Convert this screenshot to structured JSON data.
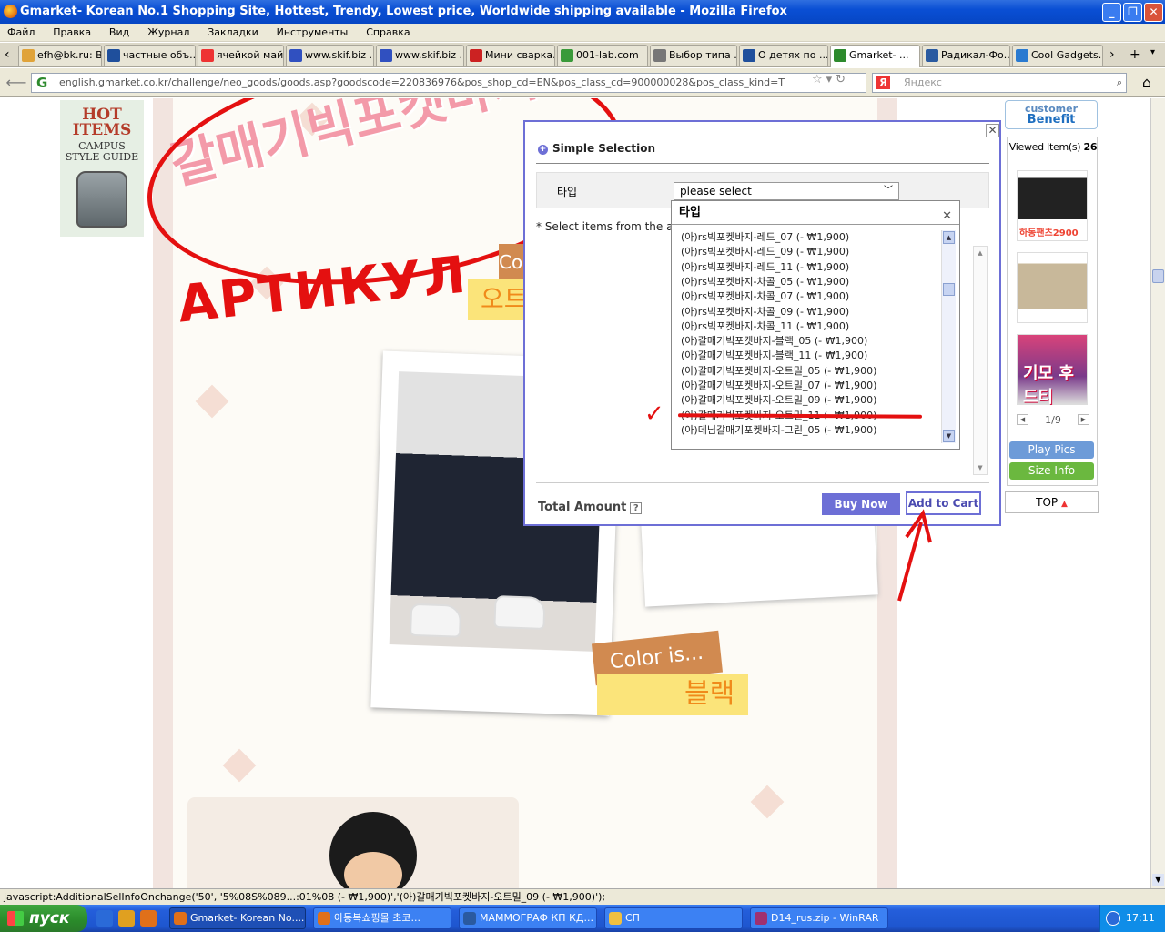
{
  "window": {
    "title": "Gmarket- Korean No.1 Shopping Site, Hottest, Trendy, Lowest price, Worldwide shipping available - Mozilla Firefox"
  },
  "menu": [
    "Файл",
    "Правка",
    "Вид",
    "Журнал",
    "Закладки",
    "Инструменты",
    "Справка"
  ],
  "tabs": [
    {
      "label": "efh@bk.ru: В...",
      "color": "#e0a33a"
    },
    {
      "label": "частные объ...",
      "color": "#1f4f9c"
    },
    {
      "label": "ячейкой май...",
      "color": "#e33"
    },
    {
      "label": "www.skif.biz ...",
      "color": "#3050c0"
    },
    {
      "label": "www.skif.biz ...",
      "color": "#3050c0"
    },
    {
      "label": "Мини сварка...",
      "color": "#c22"
    },
    {
      "label": "001-lab.com",
      "color": "#3a9a3a"
    },
    {
      "label": "Выбор типа ...",
      "color": "#777"
    },
    {
      "label": "О детях по ...",
      "color": "#1f4f9c"
    },
    {
      "label": "Gmarket- ...",
      "color": "#2d8a2d",
      "active": true
    },
    {
      "label": "Радикал-Фо...",
      "color": "#2a5aa0"
    },
    {
      "label": "Cool Gadgets...",
      "color": "#2a7ad0"
    }
  ],
  "nav": {
    "url": "english.gmarket.co.kr/challenge/neo_goods/goods.asp?goodscode=220836976&pos_shop_cd=EN&pos_class_cd=900000028&pos_class_kind=T",
    "search_placeholder": "Яндекс"
  },
  "page": {
    "hot_items": {
      "title": "HOT ITEMS",
      "subtitle": "CAMPUS STYLE GUIDE"
    },
    "product_title_ko": "갈매기빅포켓바지",
    "annotation_text": "АРТИКУЛ",
    "color_label_1": "Co",
    "color_value_1": "오트",
    "color_label_2": "Color is...",
    "color_value_2": "블랙"
  },
  "sidebar": {
    "customer": "customer",
    "benefit": "Benefit",
    "viewed_label": "Viewed Item(s)",
    "viewed_count": "26",
    "thumb1_text": "하동팬츠2900",
    "thumb3_text": "기모 후드티",
    "pager": "1/9",
    "play_pics": "Play Pics",
    "size_info": "Size Info",
    "top": "TOP"
  },
  "dialog": {
    "title": "Simple Selection",
    "type_label": "타입",
    "select_value": "please select",
    "select_note": "* Select items from the abo",
    "total_label": "Total Amount",
    "buy_now": "Buy Now",
    "add_to_cart": "Add to Cart"
  },
  "dropdown": {
    "header": "타입",
    "items": [
      "(아)rs빅포켓바지-레드_07 (- ₩1,900)",
      "(아)rs빅포켓바지-레드_09 (- ₩1,900)",
      "(아)rs빅포켓바지-레드_11 (- ₩1,900)",
      "(아)rs빅포켓바지-차콜_05 (- ₩1,900)",
      "(아)rs빅포켓바지-차콜_07 (- ₩1,900)",
      "(아)rs빅포켓바지-차콜_09 (- ₩1,900)",
      "(아)rs빅포켓바지-차콜_11 (- ₩1,900)",
      "(아)갈매기빅포켓바지-블랙_05 (- ₩1,900)",
      "(아)갈매기빅포켓바지-블랙_11 (- ₩1,900)",
      "(아)갈매기빅포켓바지-오트밀_05 (- ₩1,900)",
      "(아)갈매기빅포켓바지-오트밀_07 (- ₩1,900)",
      "(아)갈매기빅포켓바지-오트밀_09 (- ₩1,900)",
      "(아)갈매기빅포켓바지-오트밀_11 (- ₩1,900)",
      "(아)데님갈매기포켓바지-그린_05 (- ₩1,900)"
    ]
  },
  "status": "javascript:AdditionalSelInfoOnchange('50', '5%08S%089...:01%08 (- ₩1,900)','(아)갈매기빅포켓바지-오트밀_09 (- ₩1,900)');",
  "taskbar": {
    "start": "пуск",
    "tasks": [
      {
        "label": "Gmarket- Korean No....",
        "color": "#e0701a",
        "active": true
      },
      {
        "label": "아동복쇼핑몰 초코...",
        "color": "#e0701a"
      },
      {
        "label": "МАММОГРАФ КП КД...",
        "color": "#2a5aa0"
      },
      {
        "label": "СП",
        "color": "#f0c040"
      },
      {
        "label": "D14_rus.zip - WinRAR",
        "color": "#a03070"
      }
    ],
    "time": "17:11"
  }
}
